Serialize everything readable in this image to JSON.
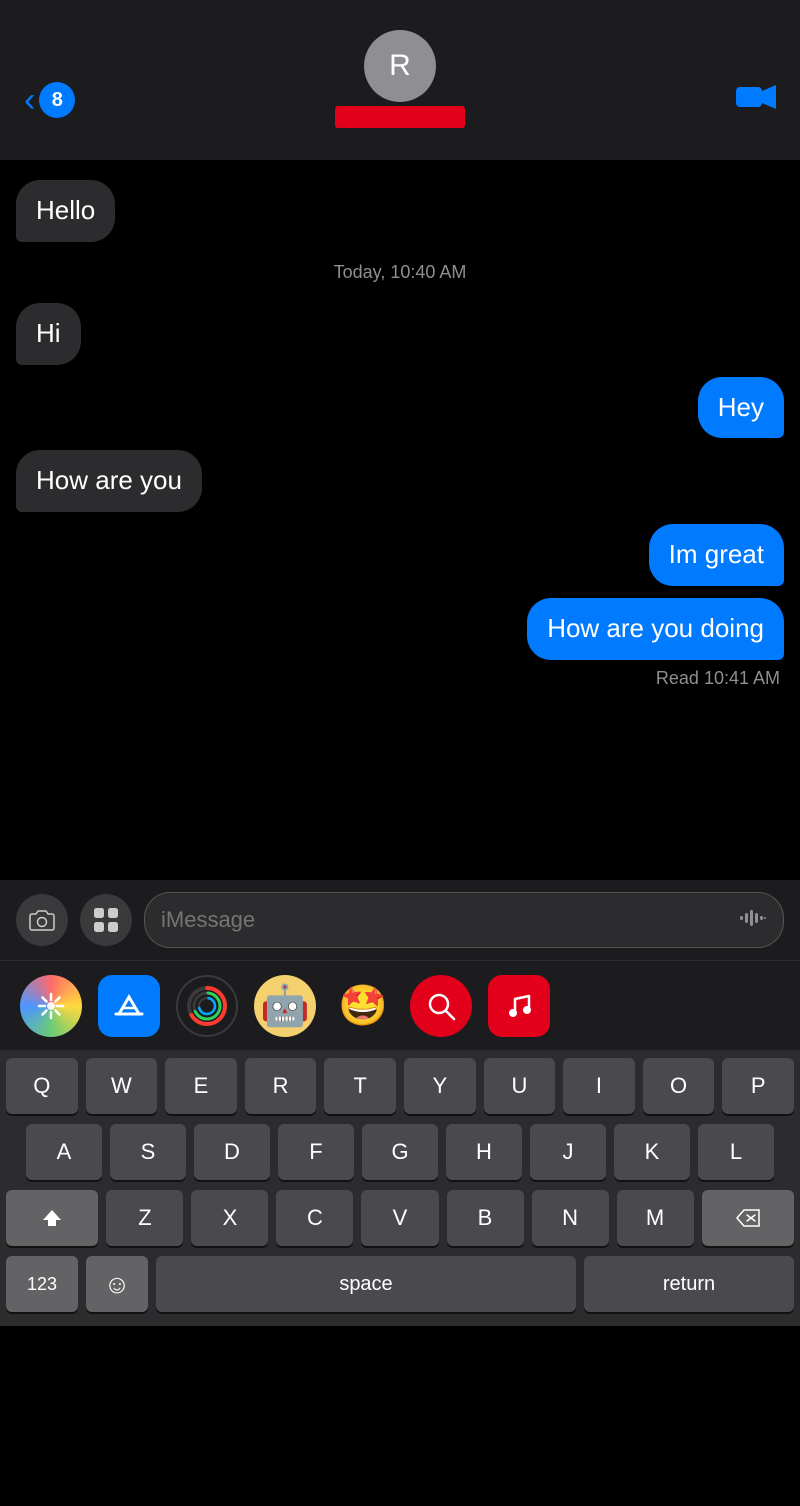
{
  "header": {
    "back_count": "8",
    "contact_initial": "R",
    "video_label": "video-call"
  },
  "messages": [
    {
      "id": "msg1",
      "text": "Hello",
      "type": "received"
    },
    {
      "id": "ts1",
      "text": "Today, 10:40 AM",
      "type": "timestamp"
    },
    {
      "id": "msg2",
      "text": "Hi",
      "type": "received"
    },
    {
      "id": "msg3",
      "text": "Hey",
      "type": "sent"
    },
    {
      "id": "msg4",
      "text": "How are you",
      "type": "received"
    },
    {
      "id": "msg5",
      "text": "Im great",
      "type": "sent"
    },
    {
      "id": "msg6",
      "text": "How are you doing",
      "type": "sent"
    },
    {
      "id": "rs1",
      "text": "Read 10:41 AM",
      "type": "read"
    }
  ],
  "input": {
    "placeholder": "iMessage"
  },
  "keyboard": {
    "rows": [
      [
        "Q",
        "W",
        "E",
        "R",
        "T",
        "Y",
        "U",
        "I",
        "O",
        "P"
      ],
      [
        "A",
        "S",
        "D",
        "F",
        "G",
        "H",
        "J",
        "K",
        "L"
      ],
      [
        "Z",
        "X",
        "C",
        "V",
        "B",
        "N",
        "M"
      ]
    ],
    "space_label": "space",
    "return_label": "return",
    "num_label": "123"
  },
  "app_drawer": {
    "apps": [
      {
        "name": "Photos",
        "icon": "📷"
      },
      {
        "name": "App Store",
        "icon": "🅰"
      },
      {
        "name": "Activity",
        "icon": "⊙"
      },
      {
        "name": "Memoji 1",
        "icon": "🤖"
      },
      {
        "name": "Memoji 2",
        "icon": "🤩"
      },
      {
        "name": "Globe Search",
        "icon": "🔍"
      },
      {
        "name": "Music",
        "icon": "🎵"
      }
    ]
  }
}
